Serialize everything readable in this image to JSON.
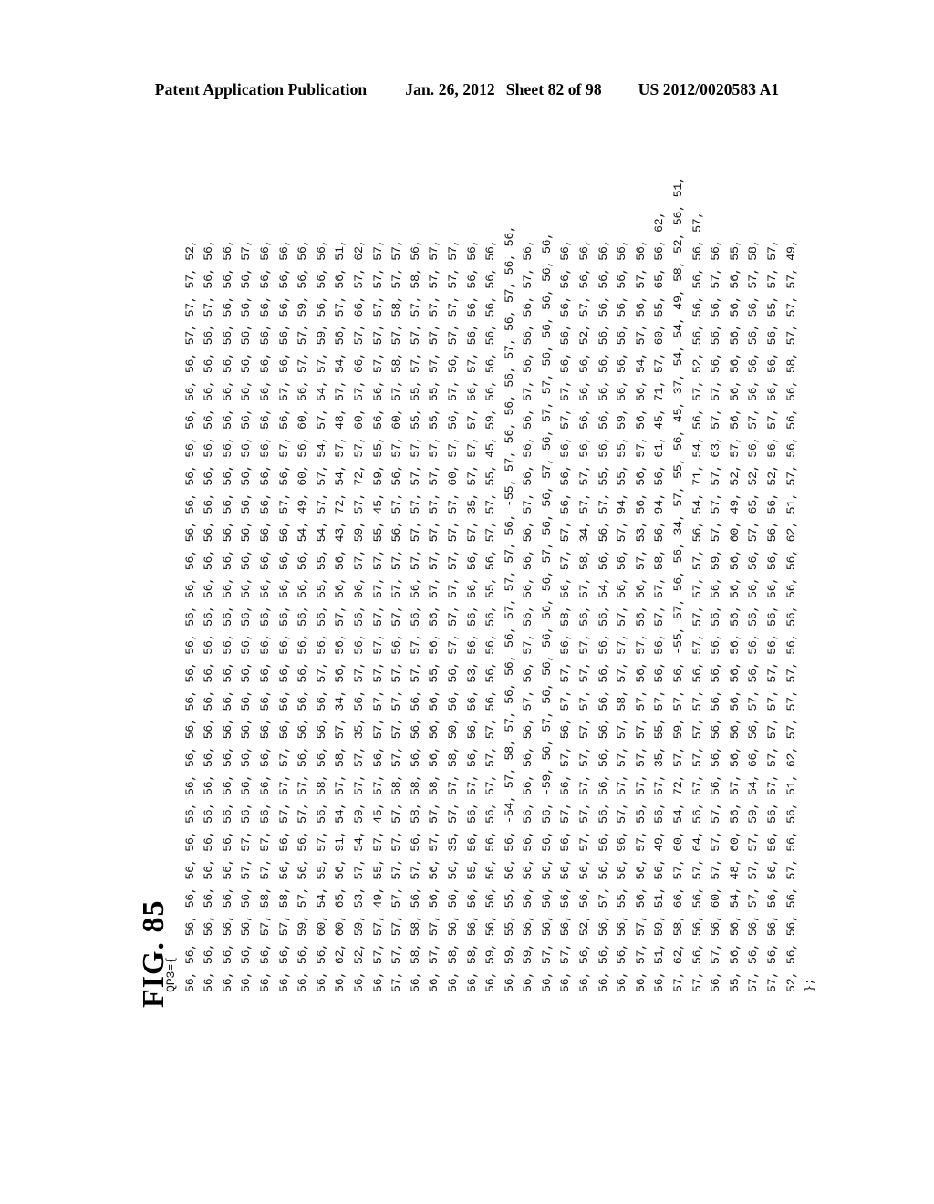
{
  "header": {
    "publication": "Patent Application Publication",
    "date": "Jan. 26, 2012",
    "sheet": "Sheet 82 of 98",
    "pub_number": "US 2012/0020583 A1"
  },
  "figure": {
    "label": "FIG. 85",
    "rotation_degrees": -90,
    "array_name": "QP3",
    "open_line": "QP3={",
    "close_line": "};"
  },
  "listing": {
    "lines": [
      "QP3={",
      "56, 56, 56, 56, 56, 56, 56, 56, 56, 56, 56, 56, 56, 56, 56, 56, 56, 56, 56, 56, 56, 56, 56, 57, 57, 57, 52,",
      "56, 56, 56, 56, 56, 56, 56, 56, 56, 56, 56, 56, 56, 56, 56, 56, 56, 56, 56, 56, 56, 56, 56, 56, 57, 56, 56,",
      "56, 56, 56, 56, 56, 56, 56, 56, 56, 56, 56, 56, 56, 56, 56, 56, 56, 56, 56, 56, 56, 56, 56, 56, 56, 56, 56,",
      "56, 56, 56, 56, 57, 57, 56, 56, 56, 56, 56, 56, 56, 56, 56, 56, 56, 56, 56, 56, 56, 56, 56, 56, 56, 56, 57,",
      "56, 56, 57, 58, 57, 57, 56, 56, 56, 56, 56, 56, 56, 56, 56, 56, 56, 56, 56, 56, 56, 56, 56, 56, 56, 56, 56,",
      "56, 56, 57, 58, 56, 56, 57, 57, 57, 56, 56, 56, 56, 56, 56, 56, 56, 57, 56, 57, 56, 57, 56, 56, 56, 56, 56,",
      "56, 56, 59, 57, 56, 56, 57, 57, 56, 56, 56, 56, 56, 56, 56, 56, 54, 49, 60, 56, 60, 56, 57, 57, 59, 56, 56,",
      "56, 56, 60, 54, 55, 57, 56, 58, 56, 56, 56, 57, 56, 56, 55, 55, 54, 57, 57, 54, 57, 54, 57, 59, 56, 56, 56,",
      "56, 62, 60, 65, 56, 91, 54, 57, 58, 57, 34, 56, 56, 57, 56, 56, 43, 72, 54, 57, 48, 57, 54, 56, 57, 56, 51,",
      "56, 52, 59, 53, 57, 54, 59, 57, 57, 35, 56, 57, 56, 56, 96, 57, 59, 57, 72, 57, 60, 57, 66, 57, 66, 57, 62,",
      "56, 57, 57, 49, 55, 57, 45, 57, 56, 57, 57, 57, 57, 57, 57, 57, 55, 45, 59, 55, 56, 56, 57, 57, 57, 57, 57,",
      "57, 57, 57, 57, 57, 57, 57, 58, 57, 57, 57, 57, 56, 57, 57, 57, 56, 57, 56, 57, 60, 57, 58, 57, 58, 57, 57,",
      "56, 58, 58, 56, 57, 56, 58, 58, 56, 56, 56, 57, 57, 56, 56, 57, 57, 57, 57, 57, 55, 55, 57, 57, 57, 58, 56,",
      "56, 57, 57, 56, 56, 57, 57, 58, 56, 56, 56, 55, 56, 56, 57, 57, 57, 57, 57, 57, 55, 55, 57, 57, 57, 57, 57,",
      "56, 58, 56, 56, 56, 35, 57, 57, 58, 50, 56, 56, 57, 57, 57, 57, 57, 57, 60, 57, 56, 57, 56, 57, 57, 57, 57,",
      "56, 58, 56, 56, 55, 56, 56, 57, 56, 56, 56, 53, 56, 56, 56, 56, 57, 35, 57, 57, 57, 56, 57, 56, 56, 56, 56,",
      "56, 59, 56, 56, 56, 56, 56, 57, 57, 57, 56, 56, 56, 56, 55, 56, 57, 57, 55, 45, 59, 56, 56, 56, 56, 56, 56,",
      "56, 59, 55, 55, 56, 56, -54, 57, 58, 57, 56, 56, 56, 57, 57, 57, 56, -55, 57, 56, 56, 56, 57, 56, 57, 56, 56,",
      "56, 59, 56, 56, 56, 56, 56, 56, 56, 56, 57, 56, 57, 56, 56, 56, 56, 57, 56, 56, 56, 57, 56, 56, 56, 57, 56,",
      "56, 57, 56, 56, 56, 56, 56, -59, 56, 57, 56, 56, 56, 56, 56, 57, 56, 56, 57, 56, 57, 57, 56, 56, 56, 56, 56,",
      "56, 57, 56, 56, 56, 56, 57, 56, 57, 56, 57, 57, 56, 58, 56, 57, 57, 56, 56, 56, 57, 57, 56, 56, 56, 56, 56,",
      "56, 56, 52, 56, 56, 57, 57, 57, 57, 57, 57, 57, 57, 56, 57, 58, 34, 57, 57, 56, 56, 56, 56, 52, 57, 56, 56,",
      "56, 56, 56, 57, 56, 56, 56, 56, 56, 56, 56, 56, 56, 56, 54, 56, 56, 57, 55, 56, 56, 56, 56, 56, 56, 56, 56,",
      "56, 56, 56, 55, 56, 96, 57, 57, 57, 57, 58, 57, 57, 57, 56, 56, 57, 94, 55, 55, 59, 56, 56, 56, 56, 56, 56,",
      "56, 57, 57, 56, 56, 57, 55, 57, 57, 57, 57, 56, 57, 56, 56, 57, 53, 56, 56, 57, 56, 56, 54, 57, 56, 57, 56,",
      "56, 51, 59, 51, 56, 49, 56, 57, 35, 55, 57, 56, 56, 57, 57, 58, 56, 94, 56, 61, 45, 71, 57, 60, 55, 65, 56, 62,",
      "57, 62, 58, 66, 57, 60, 54, 72, 57, 59, 57, 56, -55, 57, 56, 56, 34, 57, 55, 56, 45, 37, 54, 54, 49, 58, 52, 56, 51,",
      "57, 56, 56, 56, 57, 64, 56, 57, 57, 57, 57, 56, 57, 57, 57, 57, 56, 54, 71, 54, 56, 57, 52, 56, 56, 56, 56, 57,",
      "56, 57, 56, 60, 57, 57, 57, 56, 56, 56, 56, 56, 56, 56, 56, 59, 57, 57, 57, 63, 57, 57, 56, 56, 56, 57, 56,",
      "55, 56, 56, 54, 48, 60, 56, 57, 56, 56, 56, 56, 56, 56, 56, 56, 60, 49, 52, 57, 56, 56, 56, 56, 56, 56, 55,",
      "57, 56, 56, 57, 57, 57, 59, 54, 66, 56, 57, 56, 56, 56, 56, 56, 57, 65, 52, 56, 57, 56, 56, 56, 56, 57, 58,",
      "57, 56, 56, 56, 56, 56, 56, 57, 57, 57, 57, 57, 56, 56, 56, 56, 56, 56, 52, 56, 57, 56, 56, 56, 55, 57, 57,",
      "52, 56, 56, 56, 57, 56, 56, 51, 62, 57, 57, 57, 56, 56, 56, 56, 62, 51, 57, 56, 56, 56, 58, 57, 57, 57, 49,",
      "};"
    ]
  }
}
